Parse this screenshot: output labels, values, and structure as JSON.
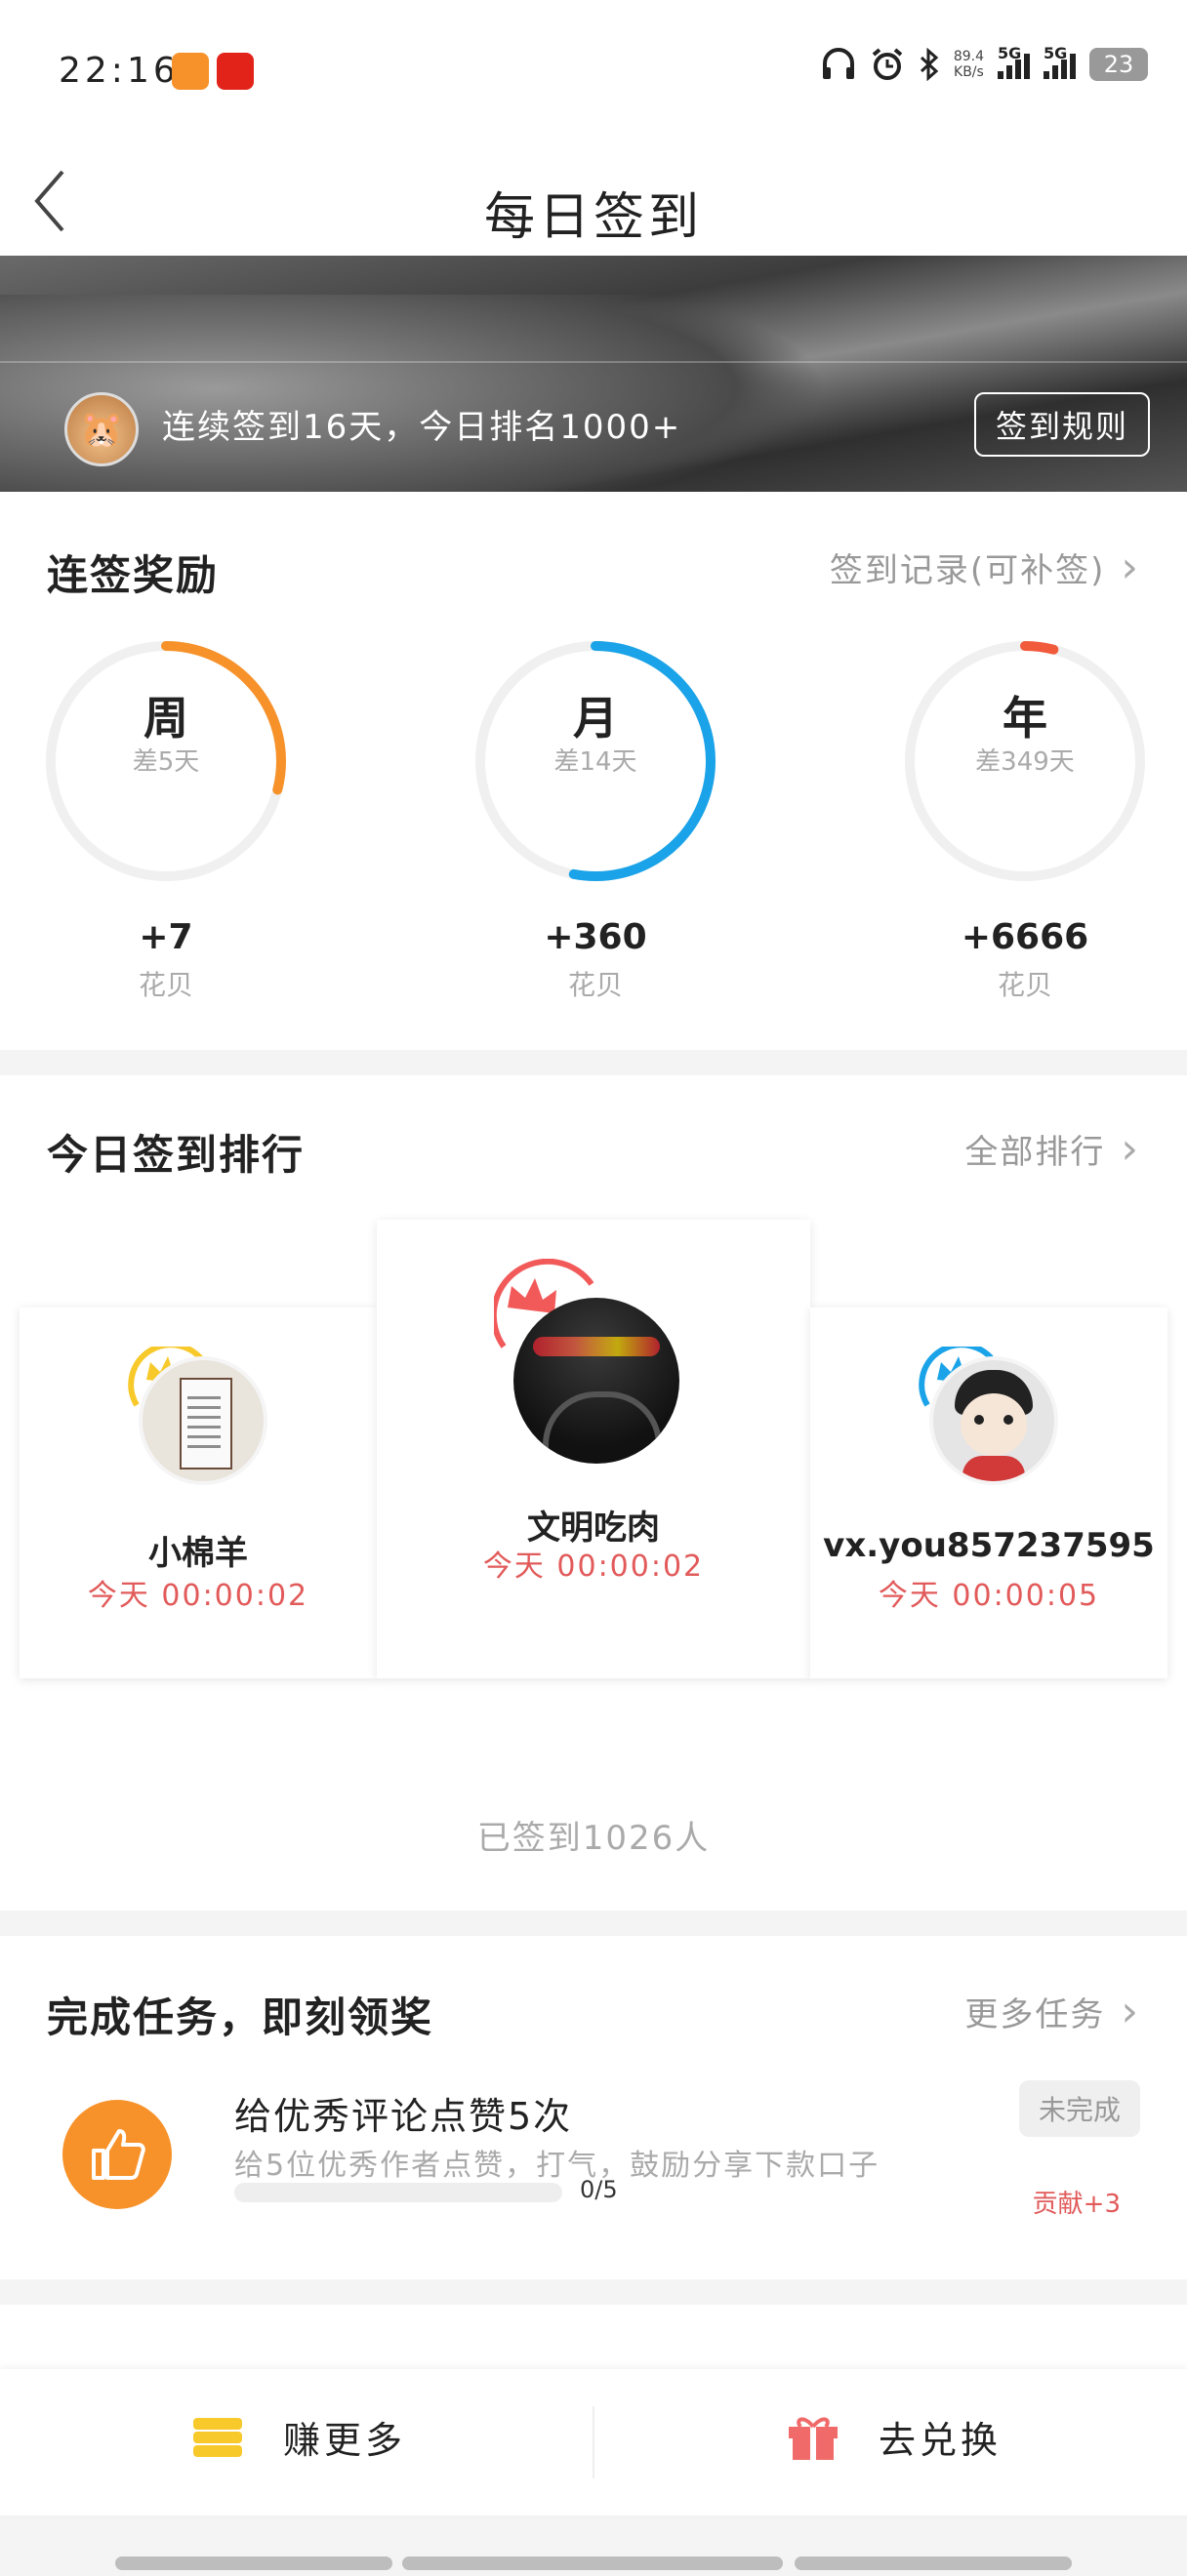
{
  "status_bar": {
    "time": "22:16",
    "net_speed": "89.4",
    "net_unit": "KB/s",
    "sig1": "5G",
    "sig2": "5G",
    "battery": "23"
  },
  "nav": {
    "back_glyph": "〈",
    "title": "每日签到"
  },
  "banner": {
    "streak_text": "连续签到16天，今日排名1000+",
    "rule_button": "签到规则"
  },
  "streak": {
    "title": "连签奖励",
    "link": "签到记录(可补签)",
    "rings": [
      {
        "label": "周",
        "remaining": "差5天",
        "reward": "+7",
        "unit": "花贝",
        "progress": 0.29,
        "color": "#f7922a"
      },
      {
        "label": "月",
        "remaining": "差14天",
        "reward": "+360",
        "unit": "花贝",
        "progress": 0.53,
        "color": "#1aa3e8"
      },
      {
        "label": "年",
        "remaining": "差349天",
        "reward": "+6666",
        "unit": "花贝",
        "progress": 0.04,
        "color": "#f25a3c"
      }
    ]
  },
  "ranking": {
    "title": "今日签到排行",
    "link": "全部排行",
    "users": [
      {
        "name": "小棉羊",
        "time": "今天 00:00:02"
      },
      {
        "name": "文明吃肉",
        "time": "今天 00:00:02"
      },
      {
        "name": "vx.you857237595",
        "time": "今天 00:00:05"
      }
    ],
    "signed_count": "已签到1026人"
  },
  "tasks": {
    "title": "完成任务，即刻领奖",
    "link": "更多任务",
    "item": {
      "title": "给优秀评论点赞5次",
      "desc": "给5位优秀作者点赞，打气，鼓励分享下款口子",
      "progress_text": "0/5",
      "progress": 0,
      "status": "未完成",
      "reward": "贡献+3"
    }
  },
  "bottom_bar": {
    "earn_label": "赚更多",
    "exchange_label": "去兑换"
  },
  "colors": {
    "accent_orange": "#f7922a",
    "accent_blue": "#1aa3e8",
    "accent_red": "#e25a5a"
  }
}
